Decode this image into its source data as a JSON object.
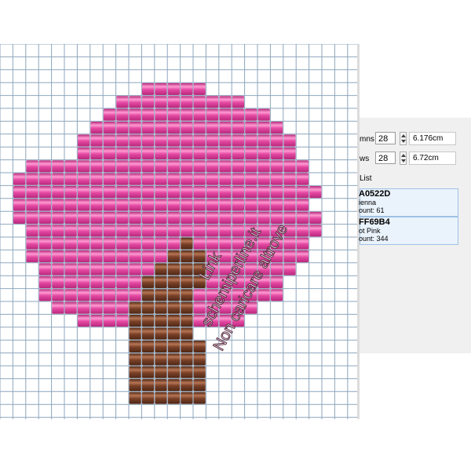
{
  "grid": {
    "line_color": "#8ea6bd",
    "background": "#ffffff",
    "columns": 28,
    "rows": 28
  },
  "pattern": {
    "colors": {
      "P": "#e54aa3",
      "B": "#7a4128"
    },
    "rows": [
      "............................",
      "............................",
      "............................",
      "...........PPPPP............",
      ".........PPPPPPPPPP.........",
      "........PPPPPPPPPPPPP.......",
      ".......PPPPPPPPPPPPPPP......",
      "......PPPPPPPPPPPPPPPPP.....",
      "......PPPPPPPPPPPPPPPPP.....",
      "..PPPPPPPPPPPPPPPPPPPPPP....",
      ".PPPPPPPPPPPPPPPPPPPPPPP....",
      ".PPPPPPPPPPPPPPPPPPPPPPPP...",
      ".PPPPPPPPPPPPPPPPPPPPPPP....",
      ".PPPPPPPPPPPPPPPPPPPPPPPP...",
      "..PPPPPPPPPPPPPPPPPPPPPPP...",
      "..PPPPPPPPPPPPBPPPPPPPPP....",
      "..PPPPPPPPPPPBBBPPPPPPPP....",
      "...PPPPPPPPPBBBBPPPPPPP.....",
      "...PPPPPPPPBBBBBPPPPPP......",
      "...PPPPPPPPBBBBPPPPPPP......",
      "....PPPPPPBBBBBPPPPP........",
      "......PPPPBBBBBPPPP.........",
      "..........BBBBB.............",
      "..........BBBBBB............",
      "..........BBBBBB............",
      "..........BBBBBB............",
      "..........BBBBBB............",
      "..........BBBBBB............"
    ]
  },
  "watermark": {
    "line1": "Link",
    "line2": "schemiperline.it",
    "line3": "Non caricare altrove"
  },
  "panel": {
    "columns_label": "mns",
    "columns_value": "28",
    "columns_size": "6.176cm",
    "rows_label": "ws",
    "rows_value": "28",
    "rows_size": "6.72cm",
    "list_title": "List",
    "colors": [
      {
        "code": "A0522D",
        "name": "ienna",
        "count": "ount: 61",
        "swatch": "#a0522d"
      },
      {
        "code": "FF69B4",
        "name": "ot Pink",
        "count": "ount: 344",
        "swatch": "#ff69b4"
      }
    ]
  }
}
